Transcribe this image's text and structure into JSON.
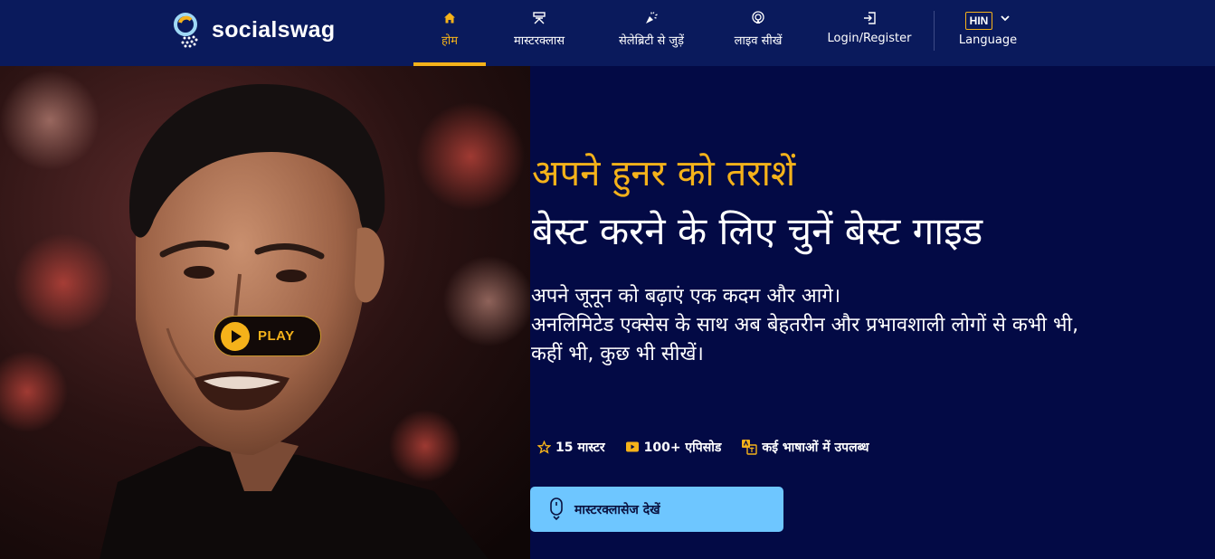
{
  "header": {
    "brand": "socialswag",
    "nav": [
      {
        "label": "होम",
        "icon": "home-icon",
        "active": true
      },
      {
        "label": "मास्टरक्लास",
        "icon": "masterclass-icon"
      },
      {
        "label": "सेलेब्रिटी से जुड़ें",
        "icon": "celebrity-icon"
      },
      {
        "label": "लाइव सीखें",
        "icon": "live-icon"
      },
      {
        "label": "Login/Register",
        "icon": "login-icon"
      }
    ],
    "language": {
      "code": "HIN",
      "label": "Language",
      "icon": "chevron-down-icon"
    }
  },
  "hero": {
    "play_label": "PLAY",
    "headline_1": "अपने हुनर को तराशें",
    "headline_2": "बेस्ट करने के लिए चुनें बेस्ट गाइड",
    "description": [
      "अपने जूनून को बढ़ाएं एक कदम और आगे।",
      "अनलिमिटेड एक्सेस के साथ अब बेहतरीन और प्रभावशाली लोगों से कभी भी,",
      "कहीं भी, कुछ भी सीखें।"
    ],
    "stats": [
      {
        "icon": "star-icon",
        "label": "15 मास्टर"
      },
      {
        "icon": "video-icon",
        "label": "100+ एपिसोड"
      },
      {
        "icon": "translate-icon",
        "label": "कई भाषाओं में उपलब्ध"
      }
    ],
    "cta_label": "मास्टरक्लासेज देखें",
    "cta_icon": "scroll-mouse-icon"
  },
  "colors": {
    "header_bg": "#0a1a5c",
    "page_bg": "#030a45",
    "accent": "#f5b21a",
    "cta_bg": "#6ec6ff"
  }
}
